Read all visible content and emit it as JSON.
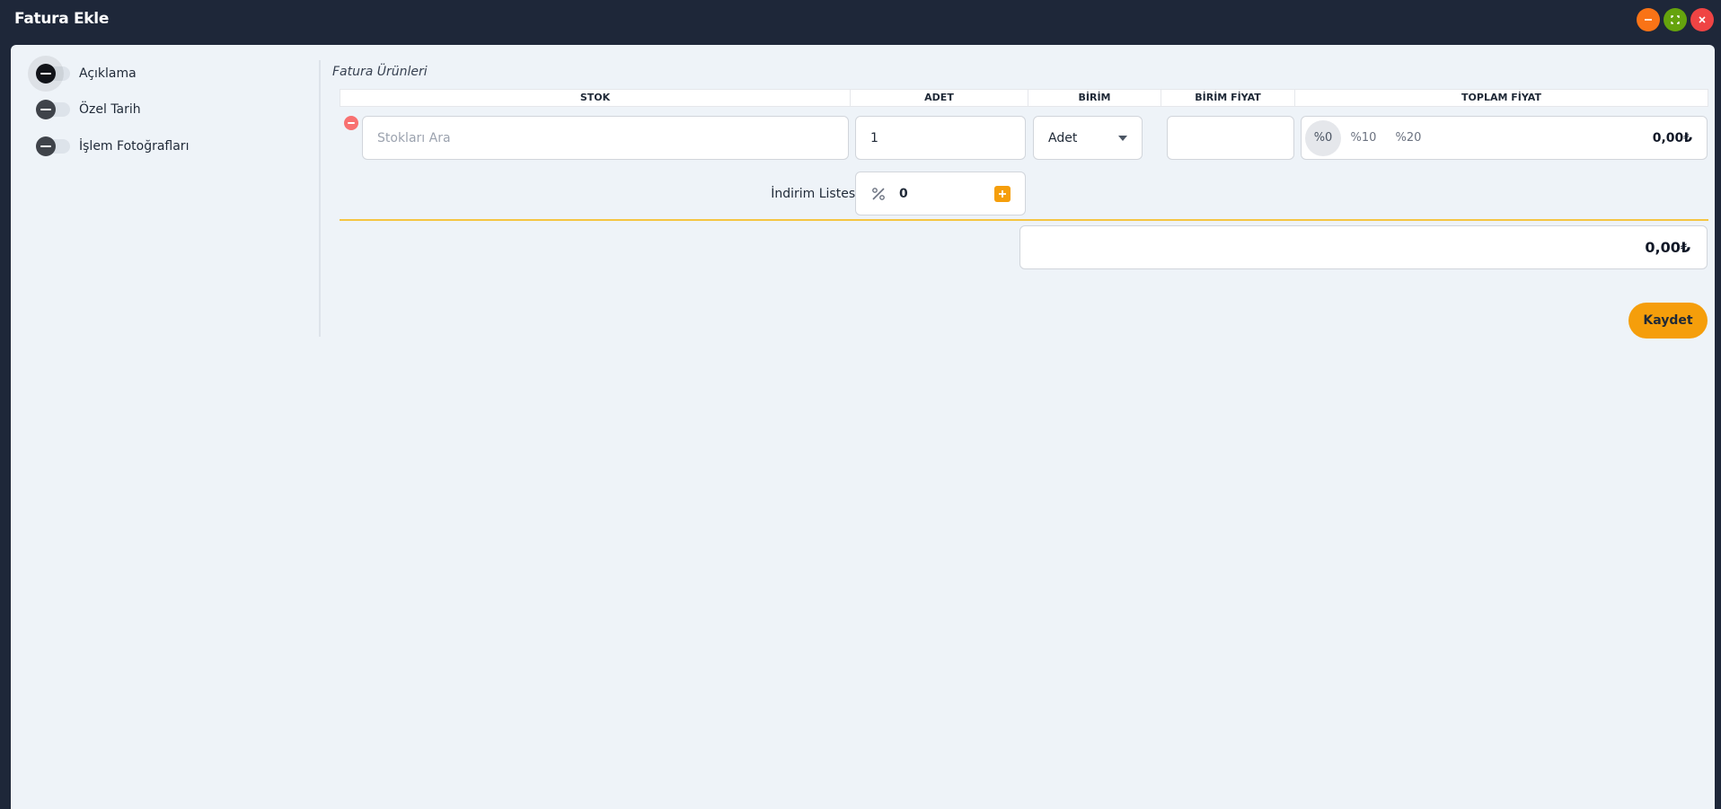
{
  "window": {
    "title": "Fatura Ekle",
    "controls": [
      "minimize-icon",
      "maximize-icon",
      "close-icon"
    ],
    "colors": {
      "minimize": "#f97316",
      "maximize": "#65a30d",
      "close": "#ef4444"
    }
  },
  "sidebar": {
    "toggles": [
      {
        "label": "Açıklama"
      },
      {
        "label": "Özel Tarih"
      },
      {
        "label": "İşlem Fotoğrafları"
      }
    ]
  },
  "invoice": {
    "section_title": "Fatura Ürünleri",
    "columns": [
      "STOK",
      "ADET",
      "BİRİM",
      "BİRİM FİYAT",
      "TOPLAM FİYAT"
    ],
    "row": {
      "stock_placeholder": "Stokları Ara",
      "quantity": "1",
      "unit": "Adet",
      "unit_price": "",
      "vat_options": [
        "%0",
        "%10",
        "%20"
      ],
      "vat_selected": "%0",
      "total": "0,00₺"
    },
    "discount": {
      "label": "İndirim Listesi",
      "value": "0"
    },
    "grand_total": "0,00₺",
    "save_label": "Kaydet"
  },
  "colors": {
    "accent": "#f59e0b",
    "titlebar": "#1e2739",
    "panel": "#eef3f8"
  }
}
